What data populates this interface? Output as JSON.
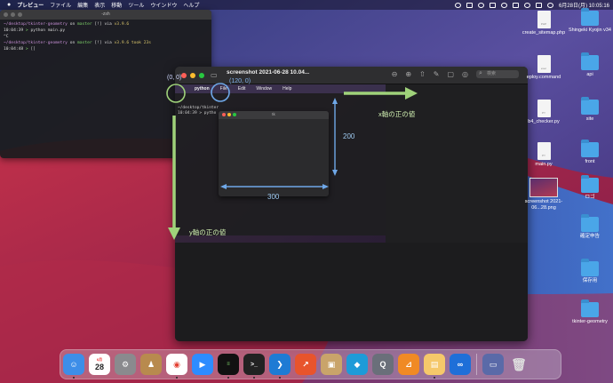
{
  "menubar": {
    "items": [
      "プレビュー",
      "ファイル",
      "編集",
      "表示",
      "移動",
      "ツール",
      "ウインドウ",
      "ヘルプ"
    ],
    "clock": "6月28日(月)  10:05:16"
  },
  "terminal": {
    "title": "-zsh",
    "lines": [
      {
        "path": "~/desktop/tkinter-geometry",
        "mid": " on ",
        "branch": "master",
        "rest": " [!] via ",
        "ver": "v3.9.6"
      },
      {
        "path": "10:04:39",
        "mid": " > ",
        "branch": "python main.py",
        "rest": "",
        "ver": ""
      },
      {
        "path": "^C",
        "mid": "",
        "branch": "",
        "rest": "",
        "ver": ""
      },
      {
        "path": "~/desktop/tkinter-geometry",
        "mid": " on ",
        "branch": "master",
        "rest": " [!] via ",
        "ver": "v3.9.6 took 23s"
      },
      {
        "path": "10:04:48",
        "mid": " > ",
        "branch": "[]",
        "rest": "",
        "ver": ""
      }
    ]
  },
  "preview": {
    "title": "screenshot 2021-06-28 10.04...",
    "search_placeholder": "検索",
    "shot_menu": [
      "python",
      "File",
      "Edit",
      "Window",
      "Help"
    ],
    "shot_term_lines": [
      "~/desktop/tkinter",
      "10:04:39 > pytho"
    ],
    "tk_title": "tk"
  },
  "annotations": {
    "origin": "(0, 0)",
    "point_120": "(120, 0)",
    "height": "200",
    "width": "300",
    "x_axis": "x軸の正の値",
    "y_axis": "y軸の正の値"
  },
  "desktop": {
    "icons": [
      {
        "label": "create_sitemap.php",
        "kind": "doc",
        "tag": "PHP"
      },
      {
        "label": "Shingeki Kyojin v34",
        "kind": "folder"
      },
      {
        "label": "eploy.command",
        "kind": "doc",
        "tag": "exec"
      },
      {
        "label": "api",
        "kind": "folder"
      },
      {
        "label": "b4_checker.py",
        "kind": "doc",
        "tag": "PY"
      },
      {
        "label": "site",
        "kind": "folder"
      },
      {
        "label": "main.py",
        "kind": "doc",
        "tag": "PY"
      },
      {
        "label": "front",
        "kind": "folder"
      },
      {
        "label": "screenshot 2021-06...28.png",
        "kind": "thumb"
      },
      {
        "label": "ロゴ",
        "kind": "folder"
      },
      {
        "label": "確定申告",
        "kind": "folder"
      },
      {
        "label": "保存用",
        "kind": "folder"
      },
      {
        "label": "tkinter-geometry",
        "kind": "folder"
      }
    ]
  },
  "dock": {
    "calendar_month": "6月",
    "calendar_day": "28"
  },
  "colors": {
    "accent_green": "#9fd27a",
    "accent_blue": "#6fa8e8",
    "folder": "#4aa6e8"
  }
}
